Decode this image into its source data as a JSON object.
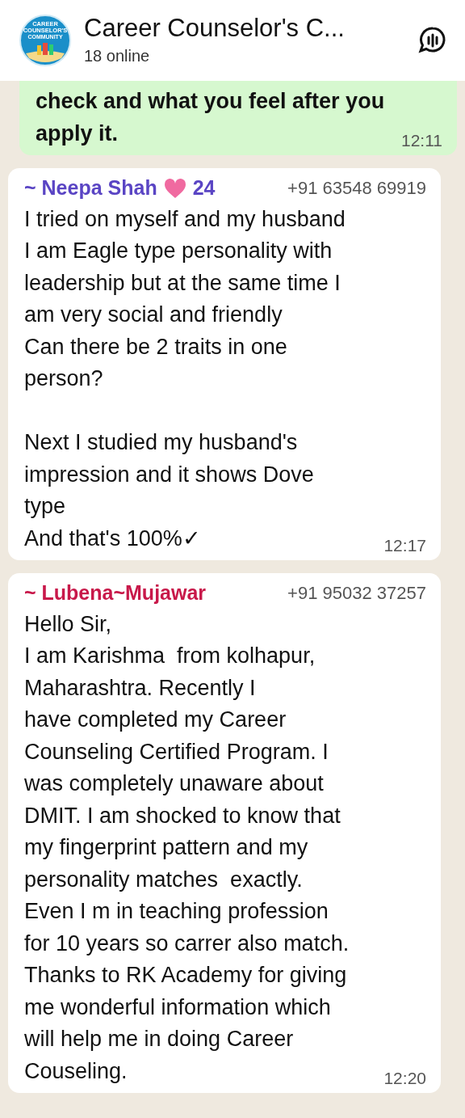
{
  "header": {
    "title": "Career Counselor's C...",
    "subtitle": "18 online",
    "logo_lines": [
      "CAREER",
      "COUNSELOR'S",
      "COMMUNITY"
    ]
  },
  "messages": [
    {
      "kind": "outgoing",
      "text": "check and what you feel after you\napply it.",
      "bold": true,
      "time": "12:11"
    },
    {
      "kind": "incoming",
      "sender": "~ Neepa Shah",
      "heart": true,
      "sender_suffix": "24",
      "color": "#5a45c4",
      "phone": "+91 63548 69919",
      "text": "I tried on myself and my husband\nI am Eagle type personality with\nleadership but at the same time I\nam very social and friendly\nCan there be 2 traits in one\nperson?\n\nNext I studied my husband's\nimpression and it shows Dove\ntype\nAnd that's 100%✓",
      "bold": false,
      "time": "12:17"
    },
    {
      "kind": "incoming",
      "sender": "~ Lubena~Mujawar",
      "heart": false,
      "color": "#c8184a",
      "phone": "+91 95032 37257",
      "text": "Hello Sir,\nI am Karishma  from kolhapur,\nMaharashtra. Recently I\nhave completed my Career\nCounseling Certified Program. I\nwas completely unaware about\nDMIT. I am shocked to know that\nmy fingerprint pattern and my\npersonality matches  exactly.\nEven I m in teaching profession\nfor 10 years so carrer also match.\nThanks to RK Academy for giving\nme wonderful information which\nwill help me in doing Career\nCouseling.",
      "bold": false,
      "time": "12:20"
    }
  ]
}
